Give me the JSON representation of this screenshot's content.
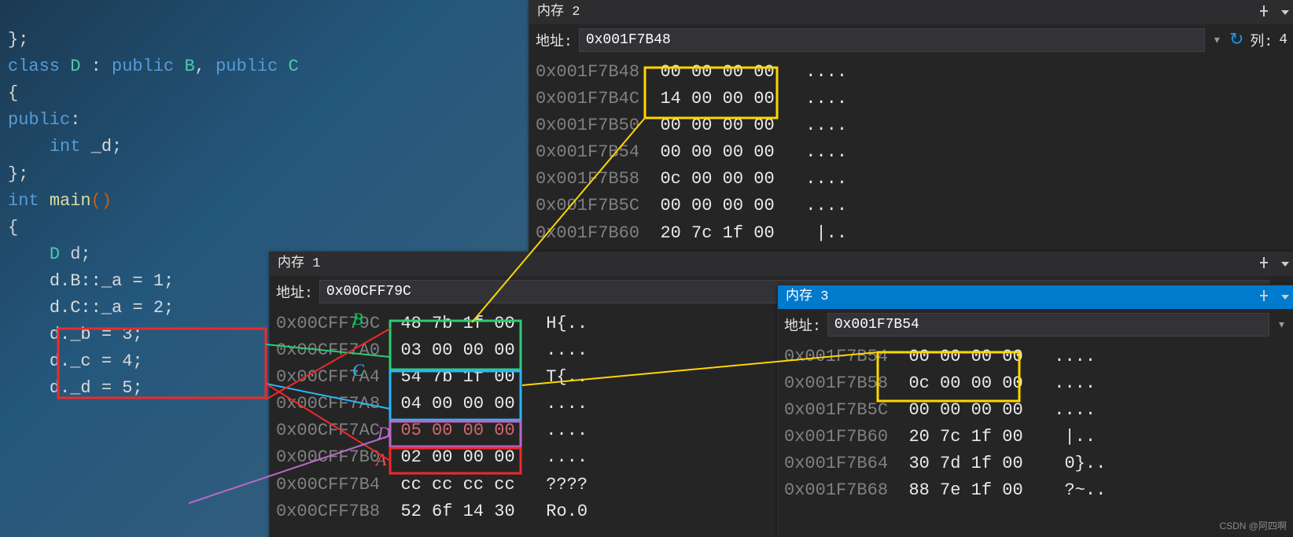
{
  "code": {
    "l1": "};",
    "l2_class": "class",
    "l2_D": "D",
    "l2_colon": ":",
    "l2_public1": "public",
    "l2_B": "B",
    "l2_comma": ",",
    "l2_public2": "public",
    "l2_C": "C",
    "l3": "{",
    "l4_public": "public",
    "l4_colon": ":",
    "l5_int": "int",
    "l5_d": "_d",
    "l5_semi": ";",
    "l6": "};",
    "l7_int": "int",
    "l7_main": "main",
    "l7_par": "()",
    "l8": "{",
    "l9_D": "D",
    "l9_d": "d",
    "l9_semi": ";",
    "l10": "d.B::_a = 1;",
    "l11": "d.C::_a = 2;",
    "l12": "d._b = 3;",
    "l13": "d._c = 4;",
    "l14": "d._d = 5;"
  },
  "panels": {
    "mem1": {
      "title": "内存 1",
      "addr_label": "地址:",
      "addr_value": "0x00CFF79C",
      "rows": [
        {
          "a": "0x00CFF79C",
          "h": "48 7b 1f 00",
          "s": "H{.."
        },
        {
          "a": "0x00CFF7A0",
          "h": "03 00 00 00",
          "s": "...."
        },
        {
          "a": "0x00CFF7A4",
          "h": "54 7b 1f 00",
          "s": "T{.."
        },
        {
          "a": "0x00CFF7A8",
          "h": "04 00 00 00",
          "s": "...."
        },
        {
          "a": "0x00CFF7AC",
          "h": "05 00 00 00",
          "s": "...."
        },
        {
          "a": "0x00CFF7B0",
          "h": "02 00 00 00",
          "s": "...."
        },
        {
          "a": "0x00CFF7B4",
          "h": "cc cc cc cc",
          "s": "????"
        },
        {
          "a": "0x00CFF7B8",
          "h": "52 6f 14 30",
          "s": "Ro.0"
        }
      ]
    },
    "mem2": {
      "title": "内存 2",
      "addr_label": "地址:",
      "addr_value": "0x001F7B48",
      "col_label": "列:",
      "col_value": "4",
      "rows": [
        {
          "a": "0x001F7B48",
          "h": "00 00 00 00",
          "s": "...."
        },
        {
          "a": "0x001F7B4C",
          "h": "14 00 00 00",
          "s": "...."
        },
        {
          "a": "0x001F7B50",
          "h": "00 00 00 00",
          "s": "...."
        },
        {
          "a": "0x001F7B54",
          "h": "00 00 00 00",
          "s": "...."
        },
        {
          "a": "0x001F7B58",
          "h": "0c 00 00 00",
          "s": "...."
        },
        {
          "a": "0x001F7B5C",
          "h": "00 00 00 00",
          "s": "...."
        },
        {
          "a": "0x001F7B60",
          "h": "20 7c 1f 00",
          "s": " |.."
        }
      ]
    },
    "mem3": {
      "title": "内存 3",
      "addr_label": "地址:",
      "addr_value": "0x001F7B54",
      "rows": [
        {
          "a": "0x001F7B54",
          "h": "00 00 00 00",
          "s": "...."
        },
        {
          "a": "0x001F7B58",
          "h": "0c 00 00 00",
          "s": "...."
        },
        {
          "a": "0x001F7B5C",
          "h": "00 00 00 00",
          "s": "...."
        },
        {
          "a": "0x001F7B60",
          "h": "20 7c 1f 00",
          "s": " |.."
        },
        {
          "a": "0x001F7B64",
          "h": "30 7d 1f 00",
          "s": " 0}.."
        },
        {
          "a": "0x001F7B68",
          "h": "88 7e 1f 00",
          "s": " ?~.."
        }
      ]
    }
  },
  "legend": {
    "B": "B",
    "C": "C",
    "D": "D",
    "A": "A"
  },
  "watermark": "CSDN @阿四啊"
}
